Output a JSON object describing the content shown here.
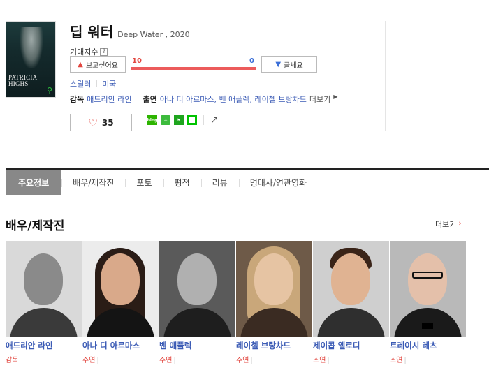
{
  "movie": {
    "title_ko": "딥 워터",
    "title_en": "Deep Water , 2020",
    "poster_text": "PATRICIA HIGHS",
    "expect_label": "기대지수",
    "expect_help": "?",
    "want_label": "보고싶어요",
    "nah_label": "글쎄요",
    "want_count": "10",
    "nah_count": "0",
    "want_ratio": 1.0,
    "genre": "스릴러",
    "country": "미국",
    "director_label": "감독",
    "director": "애드리안 라인",
    "cast_label": "출연",
    "cast_list": "아나 디 아르마스, 벤 애플렉, 레이첼 브랑차드",
    "more_label": "더보기",
    "likes": "35"
  },
  "tabs": [
    "주요정보",
    "배우/제작진",
    "포토",
    "평점",
    "리뷰",
    "명대사/연관영화"
  ],
  "section": {
    "title": "배우/제작진",
    "more": "더보기"
  },
  "people": [
    {
      "name": "애드리안 라인",
      "role": "감독"
    },
    {
      "name": "아나 디 아르마스",
      "role": "주연"
    },
    {
      "name": "벤 애플렉",
      "role": "주연"
    },
    {
      "name": "레이첼 브랑차드",
      "role": "주연"
    },
    {
      "name": "제이콥 엘로디",
      "role": "조연"
    },
    {
      "name": "트레이시 레츠",
      "role": "조연"
    }
  ],
  "colors": {
    "accent_red": "#e2463f",
    "link_blue": "#3b5bb5",
    "bar_red": "#ec5b5b"
  }
}
